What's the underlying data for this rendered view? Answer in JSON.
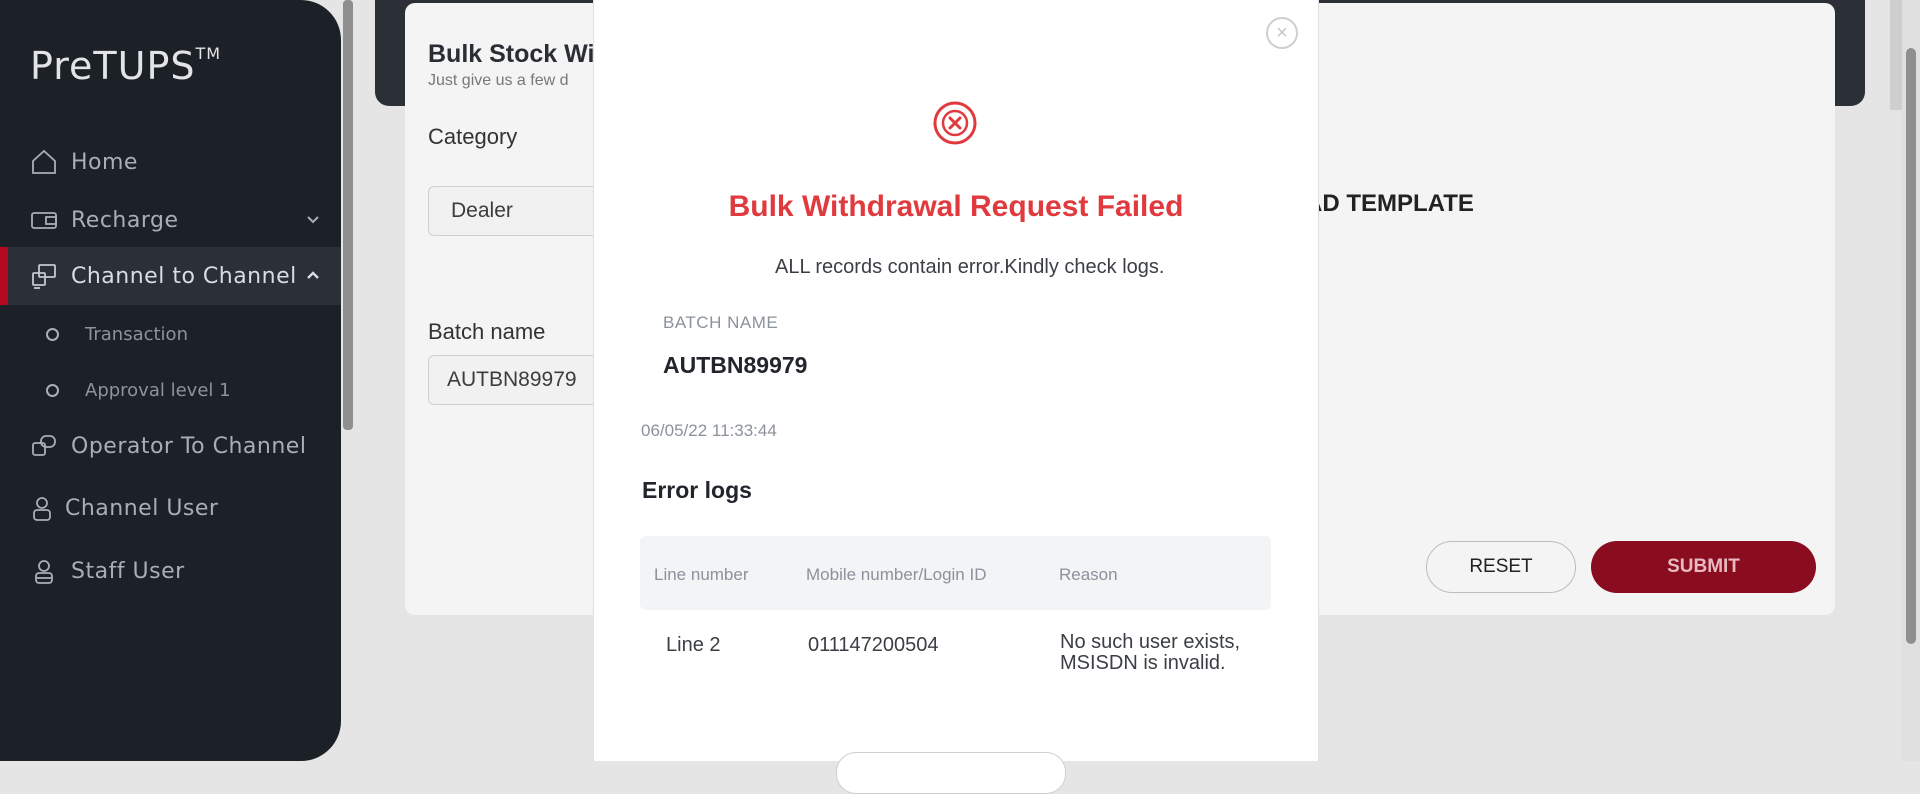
{
  "app": {
    "logo": "PreTUPS",
    "logo_tm": "TM"
  },
  "sidebar": {
    "items": [
      {
        "label": "Home",
        "icon": "home-icon"
      },
      {
        "label": "Recharge",
        "icon": "recharge-icon"
      },
      {
        "label": "Channel to Channel",
        "icon": "channel-transfer-icon",
        "active": true
      },
      {
        "label": "Operator To Channel",
        "icon": "operator-channel-icon"
      },
      {
        "label": "Channel User",
        "icon": "user-icon"
      },
      {
        "label": "Staff User",
        "icon": "staff-user-icon"
      }
    ],
    "sub_items": [
      {
        "label": "Transaction"
      },
      {
        "label": "Approval level 1"
      }
    ]
  },
  "page": {
    "title": "Bulk Stock Wi",
    "subtitle": "Just give us a few d",
    "category_label": "Category",
    "category_value": "Dealer",
    "batch_label": "Batch name",
    "batch_value": "AUTBN89979",
    "download_template": "AD TEMPLATE",
    "reset_label": "RESET",
    "submit_label": "SUBMIT"
  },
  "modal": {
    "title": "Bulk Withdrawal Request Failed",
    "message": "ALL records contain error.Kindly check logs.",
    "batch_name_label": "BATCH NAME",
    "batch_name_value": "AUTBN89979",
    "timestamp": "06/05/22 11:33:44",
    "error_logs_heading": "Error logs",
    "table": {
      "headers": [
        "Line number",
        "Mobile number/Login ID",
        "Reason"
      ],
      "rows": [
        [
          "Line 2",
          "011147200504",
          "No such user exists, MSISDN is invalid."
        ]
      ]
    },
    "colors": {
      "error": "#e03a3e",
      "brand": "#8a0c1f"
    }
  }
}
